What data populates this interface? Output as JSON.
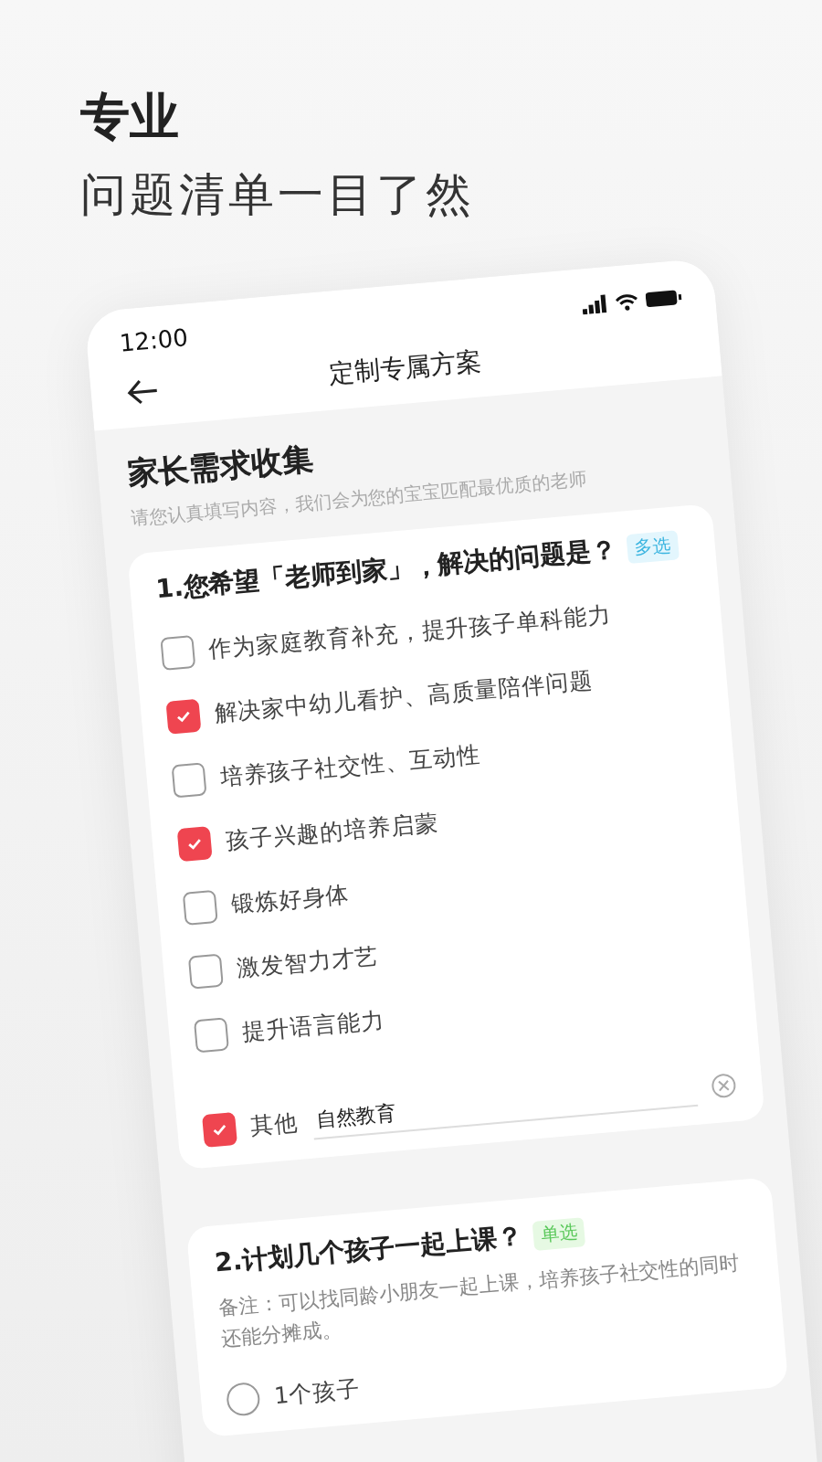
{
  "headline": {
    "title": "专业",
    "subtitle": "问题清单一目了然"
  },
  "phone": {
    "status_time": "12:00",
    "nav_title": "定制专属方案"
  },
  "form": {
    "title": "家长需求收集",
    "hint": "请您认真填写内容，我们会为您的宝宝匹配最优质的老师",
    "questions": [
      {
        "kind": "multi",
        "title": "1.您希望「老师到家」，解决的问题是？",
        "tag": "多选",
        "options": [
          {
            "label": "作为家庭教育补充，提升孩子单科能力",
            "checked": false
          },
          {
            "label": "解决家中幼儿看护、高质量陪伴问题",
            "checked": true
          },
          {
            "label": "培养孩子社交性、互动性",
            "checked": false
          },
          {
            "label": "孩子兴趣的培养启蒙",
            "checked": true
          },
          {
            "label": "锻炼好身体",
            "checked": false
          },
          {
            "label": "激发智力才艺",
            "checked": false
          },
          {
            "label": "提升语言能力",
            "checked": false
          }
        ],
        "other": {
          "label": "其他",
          "checked": true,
          "value": "自然教育"
        }
      },
      {
        "kind": "single",
        "title": "2.计划几个孩子一起上课？",
        "tag": "单选",
        "note": "备注：可以找同龄小朋友一起上课，培养孩子社交性的同时还能分摊成。",
        "options": [
          {
            "label": "1个孩子",
            "selected": false
          }
        ]
      }
    ]
  }
}
